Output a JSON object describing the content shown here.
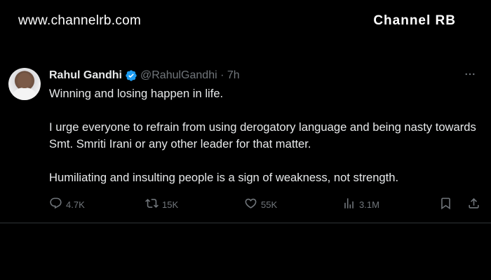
{
  "watermark": {
    "left": "www.channelrb.com",
    "right": "Channel RB"
  },
  "tweet": {
    "author_name": "Rahul Gandhi",
    "handle_time": "@RahulGandhi · 7h",
    "paragraphs": [
      "Winning and losing happen in life.",
      "I urge everyone to refrain from using derogatory language and being nasty towards Smt. Smriti Irani or any other leader for that matter.",
      "Humiliating and insulting people is a sign of weakness, not strength."
    ],
    "metrics": {
      "replies": "4.7K",
      "reposts": "15K",
      "likes": "55K",
      "views": "3.1M"
    }
  },
  "icons": {
    "verified": "verified-badge-icon",
    "more": "more-icon",
    "reply": "reply-icon",
    "repost": "repost-icon",
    "like": "heart-icon",
    "views": "views-icon",
    "bookmark": "bookmark-icon",
    "share": "share-icon"
  },
  "colors": {
    "background": "#000000",
    "text": "#e7e9ea",
    "muted": "#71767b",
    "verified": "#1d9bf0",
    "divider": "#2f3336"
  }
}
